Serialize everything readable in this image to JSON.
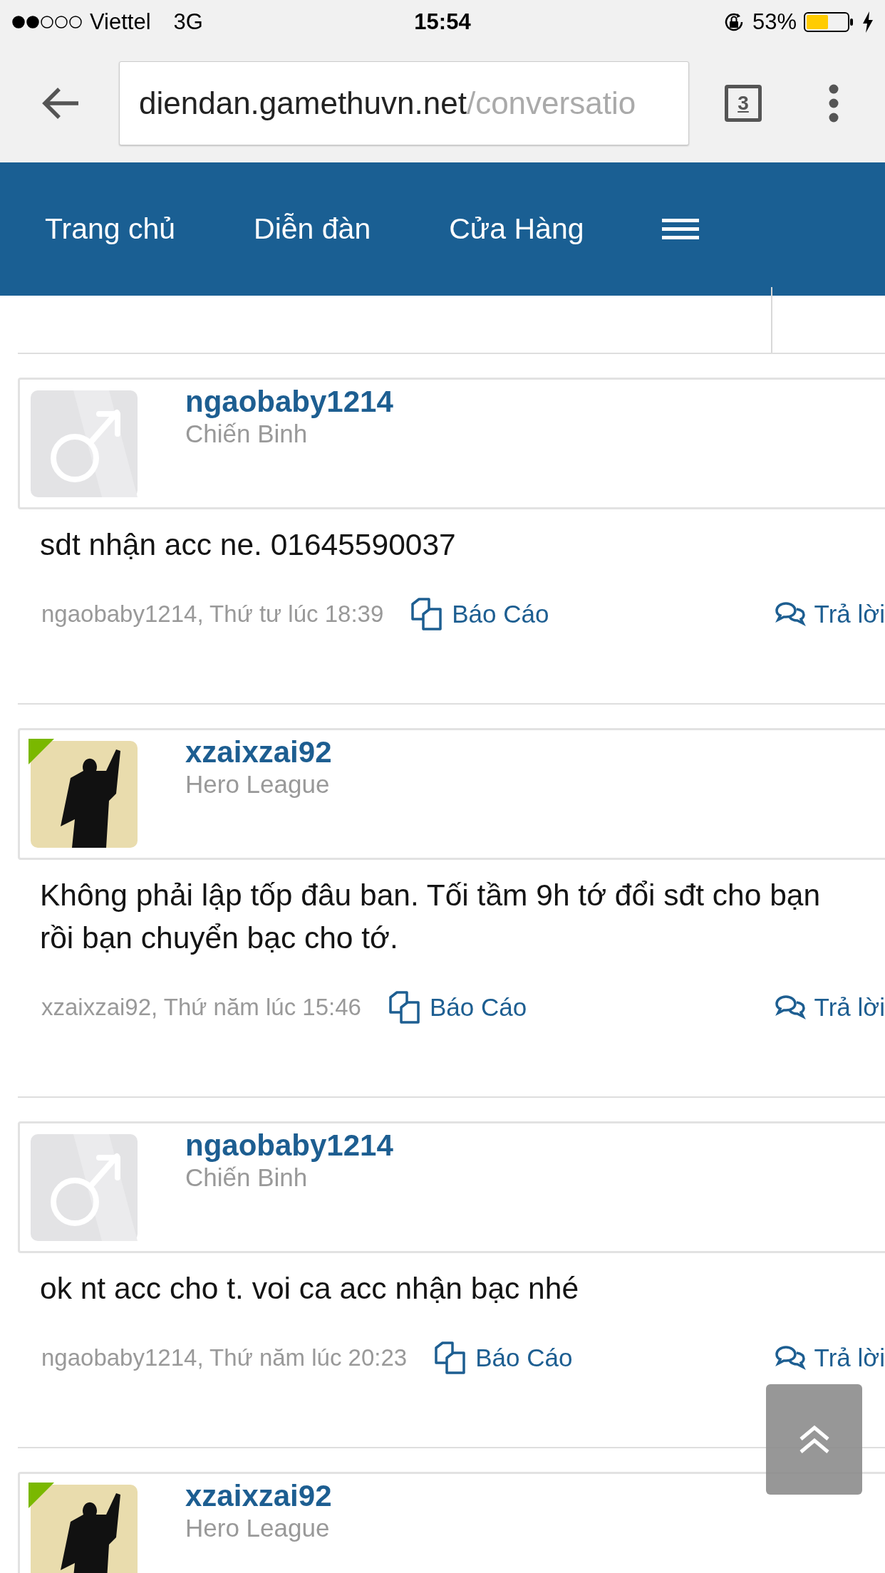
{
  "status_bar": {
    "carrier": "Viettel",
    "network": "3G",
    "time": "15:54",
    "battery_percent": "53%"
  },
  "browser": {
    "url_domain": "diendan.gamethuvn.net",
    "url_path": "/conversatio",
    "tab_count": "3"
  },
  "nav": {
    "items": [
      {
        "label": "Trang chủ"
      },
      {
        "label": "Diễn đàn"
      },
      {
        "label": "Cửa Hàng"
      }
    ]
  },
  "posts": [
    {
      "author": "ngaobaby1214",
      "rank": "Chiến Binh",
      "kind": "default",
      "online": false,
      "message": "sdt nhận acc ne. 01645590037",
      "meta": "ngaobaby1214, Thứ tư lúc 18:39",
      "report": "Báo Cáo",
      "reply": "Trả lời"
    },
    {
      "author": "xzaixzai92",
      "rank": "Hero League",
      "kind": "photo",
      "online": true,
      "message": "Không phải lập tốp đâu ban. Tối tầm 9h tớ đổi sđt cho bạn rồi bạn chuyển bạc cho tớ.",
      "meta": "xzaixzai92, Thứ năm lúc 15:46",
      "report": "Báo Cáo",
      "reply": "Trả lời"
    },
    {
      "author": "ngaobaby1214",
      "rank": "Chiến Binh",
      "kind": "default",
      "online": false,
      "message": "ok nt acc cho t. voi ca acc nhận bạc nhé",
      "meta": "ngaobaby1214, Thứ năm lúc 20:23",
      "report": "Báo Cáo",
      "reply": "Trả lời"
    },
    {
      "author": "xzaixzai92",
      "rank": "Hero League",
      "kind": "photo",
      "online": true
    }
  ]
}
